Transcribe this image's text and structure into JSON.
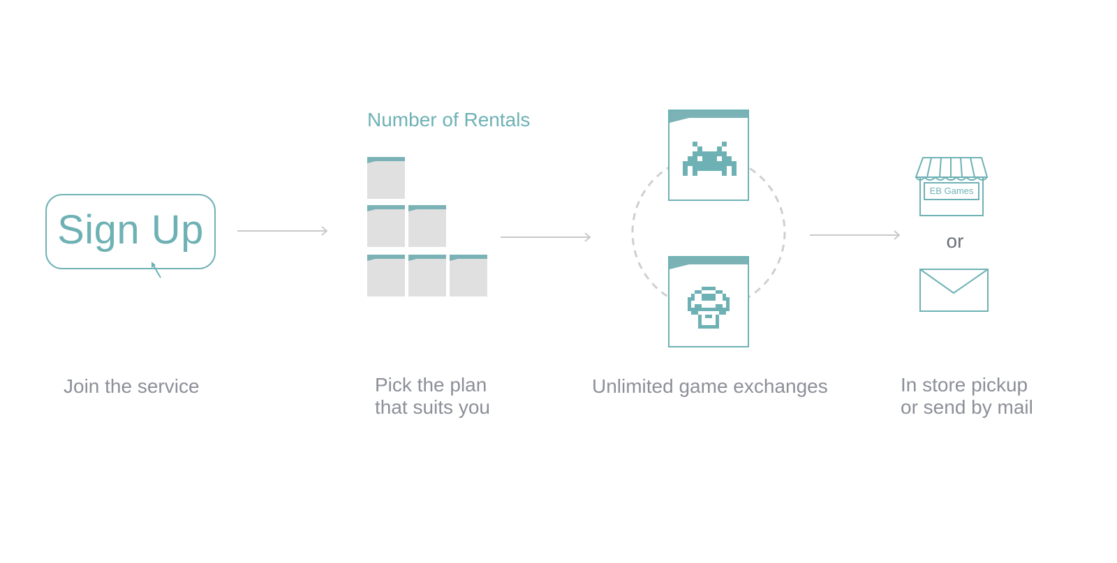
{
  "signup": {
    "button_label": "Sign Up",
    "caption": "Join the service"
  },
  "plan": {
    "title": "Number of Rentals",
    "caption_line1": "Pick the plan",
    "caption_line2": "that suits you"
  },
  "exchange": {
    "caption": "Unlimited game exchanges"
  },
  "delivery": {
    "store_sign": "EB Games",
    "or_label": "or",
    "caption_line1": "In store pickup",
    "caption_line2": "or send by mail"
  },
  "colors": {
    "accent": "#6eb1b4",
    "caption_text": "#8c8f98",
    "tile_fill": "#e0e0e1",
    "arrow": "#c9c9c9",
    "dashed_circle": "#cfcfcf"
  },
  "icons": [
    "cursor-icon",
    "arrow-right-icon",
    "space-invader-icon",
    "mushroom-icon",
    "store-icon",
    "envelope-icon"
  ]
}
